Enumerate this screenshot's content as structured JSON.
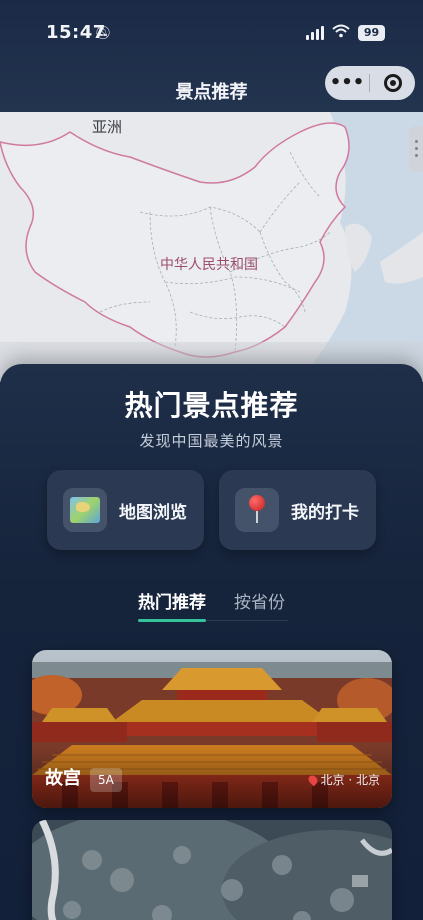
{
  "status_bar": {
    "time": "15:47",
    "battery": "99",
    "bell_icon": "bell-slash-icon",
    "signal_icon": "cellular-signal-icon",
    "wifi_icon": "wifi-icon"
  },
  "nav": {
    "title": "景点推荐",
    "more_icon": "more-dots-icon",
    "close_icon": "target-circle-icon"
  },
  "map": {
    "continent_label": "亚洲",
    "country_label": "中华人民共和国",
    "colors": {
      "land": "#e7e9ec",
      "sea": "#cbd9e6",
      "border": "#d07aa0"
    }
  },
  "panel": {
    "title": "热门景点推荐",
    "subtitle": "发现中国最美的风景"
  },
  "quick_actions": [
    {
      "label": "地图浏览",
      "icon": "map-icon"
    },
    {
      "label": "我的打卡",
      "icon": "pushpin-icon"
    }
  ],
  "tabs": [
    {
      "label": "热门推荐",
      "active": true
    },
    {
      "label": "按省份",
      "active": false
    }
  ],
  "accent_color": "#36c39c",
  "attractions": [
    {
      "name": "故宫",
      "grade": "5A",
      "location": "北京 · 北京"
    }
  ]
}
